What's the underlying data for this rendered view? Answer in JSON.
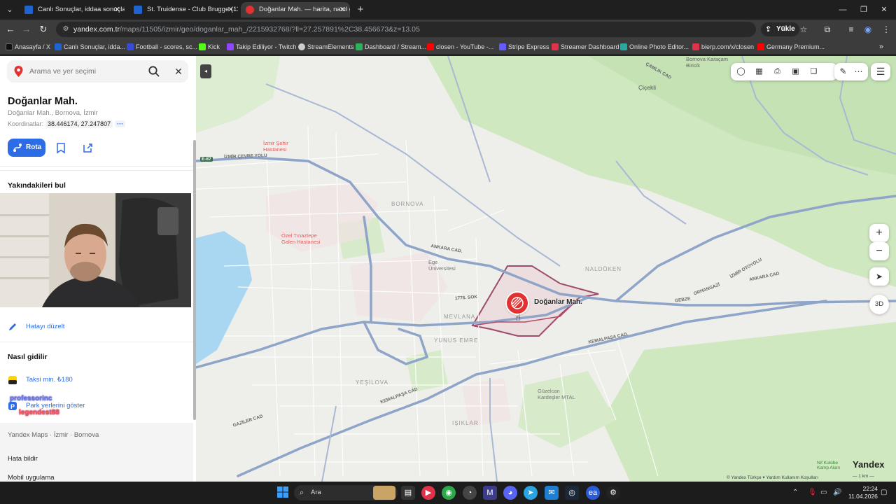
{
  "browser": {
    "tabs": [
      {
        "title": "Canlı Sonuçlar, iddaa sonuçları",
        "active": false,
        "favicon_color": "#1e64d0"
      },
      {
        "title": "St. Truidense - Club Brugge (11.",
        "active": false,
        "favicon_color": "#1e64d0"
      },
      {
        "title": "Doğanlar Mah. — harita, nasıl g",
        "active": true,
        "favicon_color": "#e23131"
      }
    ],
    "url_host": "yandex.com.tr",
    "url_path": "/maps/11505/izmir/geo/doganlar_mah_/2215932768/?ll=27.257891%2C38.456673&z=13.05",
    "upload_label": "Yükle",
    "bookmarks": [
      {
        "label": "Anasayfa / X",
        "color": "#111111"
      },
      {
        "label": "Canlı Sonuçlar, idda...",
        "color": "#1e64d0"
      },
      {
        "label": "Football - scores, sc...",
        "color": "#3a4ad8"
      },
      {
        "label": "Kick",
        "color": "#53fc18"
      },
      {
        "label": "Takip Ediliyor - Twitch",
        "color": "#9146ff"
      },
      {
        "label": "StreamElements",
        "color": "#cccccc"
      },
      {
        "label": "Dashboard / Stream...",
        "color": "#2bb35a"
      },
      {
        "label": "closen - YouTube -...",
        "color": "#ff0000"
      },
      {
        "label": "Stripe Express",
        "color": "#635bff"
      },
      {
        "label": "Streamer Dashboard",
        "color": "#e0334a"
      },
      {
        "label": "Online Photo Editor...",
        "color": "#2aa8a0"
      },
      {
        "label": "bierp.com/x/closen",
        "color": "#e0334a"
      },
      {
        "label": "Germany Premium...",
        "color": "#ff0000"
      }
    ]
  },
  "sidebar": {
    "search_placeholder": "Arama ve yer seçimi",
    "title": "Doğanlar Mah.",
    "subtitle": "Doğanlar Mah., Bornova, İzmir",
    "coords_label": "Koordinatlar:",
    "coords_value": "38.446174, 27.247807",
    "route_label": "Rota",
    "nearby_heading": "Yakındakileri bul",
    "edit_label": "Hatayı düzelt",
    "directions_heading": "Nasıl gidilir",
    "taxi_label": "Taksi min. ₺180",
    "parking_label": "Park yerlerini göster",
    "chat_user1": "professorinc",
    "chat_user2": "legendest88",
    "breadcrumb": "Yandex Maps · İzmir · Bornova",
    "report_label": "Hata bildir",
    "mobile_label": "Mobil uygulama"
  },
  "map": {
    "pin_label": "Doğanlar Mah.",
    "labels": {
      "cicekli": "Çiçekli",
      "bornova": "BORNOVA",
      "mevlana": "MEVLANA",
      "yunus_emre": "YUNUS EMRE",
      "yesilova": "YEŞİLOVA",
      "izmir_sehir": "İzmir Şehir\nHastanesi",
      "ozel_hastane": "Özel Tınaztepe\nGalen Hastanesi",
      "ege_uni": "Ege\nÜniversitesi",
      "guzelcan": "Güzelcan\nKardeşler MTAL",
      "bornova_karacam": "Bornova Karaçam\nBiricik",
      "naldoken": "NALDÖKEN",
      "ankara_cad": "ANKARA CAD.",
      "ankara_cad2": "ANKARA CAD",
      "kemalpasa_cad": "KEMALPAŞA CAD.",
      "kemalpasa_cad2": "KEMALPAŞA CAD",
      "izmir_cevre_yolu": "İZMİR ÇEVRE YOLU",
      "camlik_cad": "ÇAMLIK CAD",
      "isiklar": "IŞIKLAR",
      "gazi_cad": "GAZİLER CAD",
      "e87": "E-87",
      "sok1776": "1776. SOK",
      "izmir_otoyolu": "İZMİR OTOYOLU",
      "orhangazi": "ORHANGAZİ",
      "gebze": "GEBZE"
    },
    "attribution": "© Yandex   Türkçe ▾   Yardım   Kullanım Koşulları",
    "scale": "— 1 km —",
    "brand": "Yandex",
    "kamp_label": "Nif Kulübe\nKamp Alanı",
    "threed_label": "3D",
    "zoom_in": "+",
    "zoom_out": "−"
  },
  "taskbar": {
    "search_label": "Ara",
    "time": "22:24",
    "date": "11.04.2026"
  }
}
